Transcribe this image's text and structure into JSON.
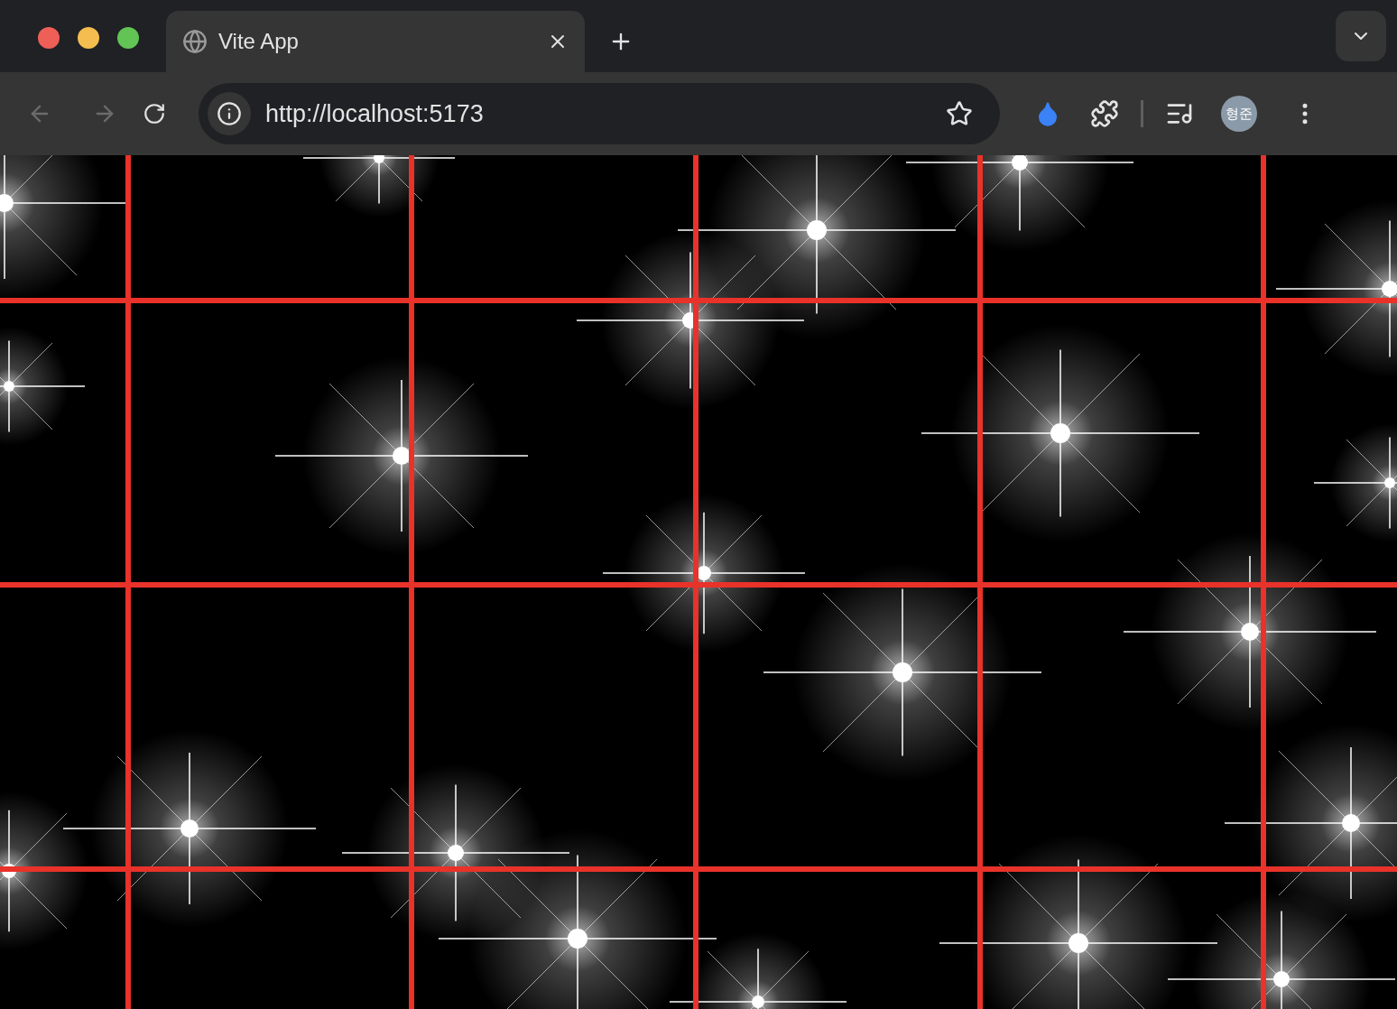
{
  "tabs": [
    {
      "title": "Vite App",
      "selected": true
    }
  ],
  "toolbar": {
    "back_disabled": true,
    "forward_disabled": true,
    "address": "http://localhost:5173",
    "profile_initials": "형준"
  }
}
